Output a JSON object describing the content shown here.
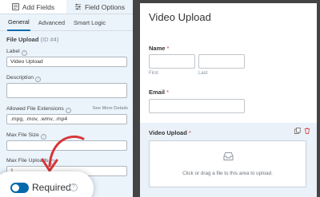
{
  "panel": {
    "tabs": [
      {
        "label": "Add Fields",
        "icon": "add-fields-icon"
      },
      {
        "label": "Field Options",
        "icon": "sliders-icon"
      }
    ],
    "subtabs": [
      "General",
      "Advanced",
      "Smart Logic"
    ],
    "field_title": "File Upload",
    "field_id": "(ID #4)",
    "label_caption": "Label",
    "label_value": "Video Upload",
    "description_caption": "Description",
    "description_value": "",
    "extensions_caption": "Allowed File Extensions",
    "extensions_more": "See More Details",
    "extensions_value": ".mpg, .mov, .wmv, .mp4",
    "max_size_caption": "Max File Size",
    "max_size_value": "",
    "max_uploads_caption": "Max File Uploads",
    "max_uploads_value": "1",
    "required_label": "Required",
    "required_on": true
  },
  "preview": {
    "title": "Video Upload",
    "name_label": "Name",
    "first_sub": "First",
    "last_sub": "Last",
    "email_label": "Email",
    "upload_label": "Video Upload",
    "dropzone_text": "Click or drag a file to this area to upload."
  },
  "colors": {
    "accent": "#056aab",
    "required_star": "#d63638",
    "arrow": "#d63638",
    "panel_bg": "#ebf3fb"
  }
}
